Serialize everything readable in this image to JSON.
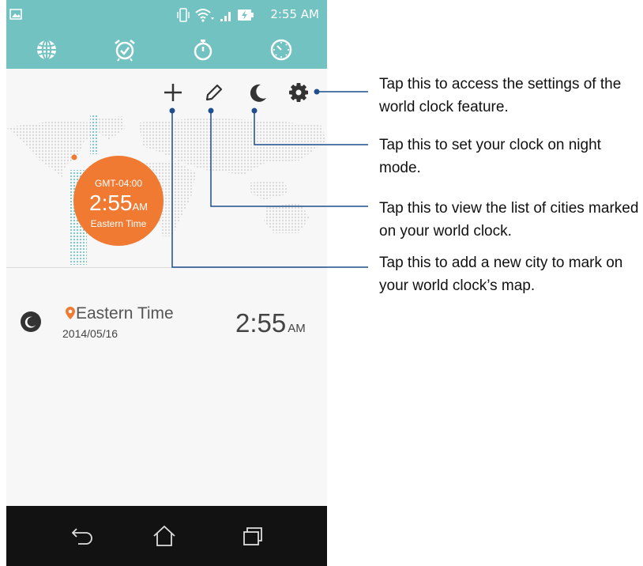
{
  "status_bar": {
    "time": "2:55 AM"
  },
  "tabs": [
    {
      "name": "world-clock",
      "icon": "globe-icon"
    },
    {
      "name": "alarm",
      "icon": "alarm-clock-icon"
    },
    {
      "name": "stopwatch",
      "icon": "stopwatch-icon"
    },
    {
      "name": "timer",
      "icon": "timer-icon"
    }
  ],
  "actions": [
    "plus-icon",
    "pencil-icon",
    "moon-icon",
    "gear-icon"
  ],
  "badge": {
    "gmt": "GMT-04:00",
    "time": "2:55",
    "ampm": "AM",
    "zone": "Eastern Time"
  },
  "city": {
    "name": "Eastern Time",
    "date": "2014/05/16",
    "time": "2:55",
    "ampm": "AM"
  },
  "nav": [
    "back-icon",
    "home-icon",
    "recent-apps-icon"
  ],
  "colors": {
    "accent": "#73c2c2",
    "orange": "#f07a32",
    "callout": "#1f4e8c",
    "nav_bg": "#121212"
  },
  "annotations": [
    "Tap this to access the settings of the world clock feature.",
    "Tap this to set your clock on night mode.",
    "Tap this to view the list of cities marked on your world clock.",
    "Tap this to add a new city to mark on your world clock’s map."
  ]
}
